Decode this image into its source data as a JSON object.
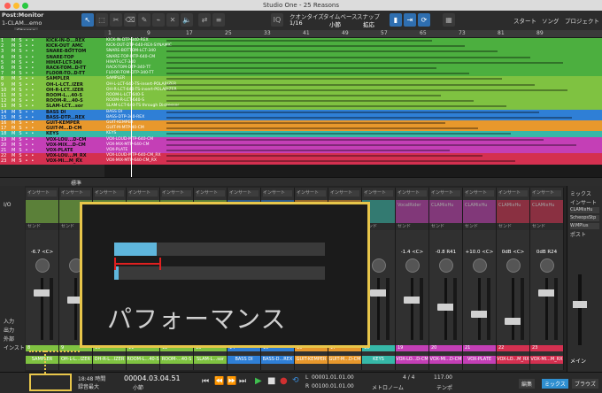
{
  "window": {
    "title": "Studio One - 25 Reasons"
  },
  "song": {
    "line1": "Post:Monitor",
    "line2": "1-CLAM...emo",
    "preset": "Stereo"
  },
  "toolbar": {
    "quantize_label": "クオンタイズ",
    "quantize_value": "1/16",
    "timebase_label": "タイムベース",
    "timebase_value": "小節",
    "snap_label": "スナップ",
    "snap_value": "拡応",
    "start_label": "スタート",
    "song_label": "ソング",
    "project_label": "プロジェクト"
  },
  "ruler": {
    "marks": [
      "1",
      "9",
      "17",
      "25",
      "33",
      "41",
      "49",
      "57",
      "65",
      "73",
      "81",
      "89"
    ]
  },
  "tracks": [
    {
      "num": "1",
      "name": "KICK-IN-D...REX",
      "clip": "KICK-IN-DTP-340-REX",
      "color": "#4caf3f"
    },
    {
      "num": "2",
      "name": "KICK-OUT_AMC",
      "clip": "KICK-OUT-DTP-640-REX-SYNAMIC",
      "color": "#4caf3f"
    },
    {
      "num": "3",
      "name": "SNARE-BOTTOM",
      "clip": "SNARE-BOTTOM-LCT-340",
      "color": "#4caf3f"
    },
    {
      "num": "4",
      "name": "SNARE-TOP",
      "clip": "SNARE-TOP-MTP-640-CM",
      "color": "#4caf3f"
    },
    {
      "num": "5",
      "name": "HIHAT-LCT-340",
      "clip": "HIHAT-LCT-340",
      "color": "#4caf3f"
    },
    {
      "num": "6",
      "name": "RACK-TOM..D-TT",
      "clip": "RACK-TOM-DTP-340-TT",
      "color": "#4caf3f"
    },
    {
      "num": "7",
      "name": "FLOOR-TO..D-TT",
      "clip": "FLOOR-TOM-DTP-340-TT",
      "color": "#4caf3f"
    },
    {
      "num": "8",
      "name": "SAMPLER",
      "clip": "SAMPLER",
      "color": "#7fc241"
    },
    {
      "num": "9",
      "name": "OH-L-LCT..IZER",
      "clip": "OH-L-LCT-640-TS-insert-POLARIZER",
      "color": "#7fc241"
    },
    {
      "num": "10",
      "name": "OH-R-LCT..IZER",
      "clip": "OH-R-LCT-640-TS-insert-POLARIZER",
      "color": "#7fc241"
    },
    {
      "num": "11",
      "name": "ROOM-L...40-S",
      "clip": "ROOM-L-LCT-640-S",
      "color": "#7fc241"
    },
    {
      "num": "12",
      "name": "ROOM-R...40-S",
      "clip": "ROOM-R-LCT-640-S",
      "color": "#7fc241"
    },
    {
      "num": "13",
      "name": "SLAM-LCT...sor",
      "clip": "SLAM-LCT-640-TS through Distressor",
      "color": "#7fc241"
    },
    {
      "num": "14",
      "name": "BASS DI",
      "clip": "BASS DI",
      "color": "#2f7fd6"
    },
    {
      "num": "15",
      "name": "BASS-DTP...REX",
      "clip": "BASS-DTP-340-REX",
      "color": "#2f7fd6"
    },
    {
      "num": "16",
      "name": "GUIT-KEMPER",
      "clip": "GUIT-KEMPER",
      "color": "#e8982c"
    },
    {
      "num": "17",
      "name": "GUIT-M...D-CM",
      "clip": "GUIT-M-MTP-40-CM",
      "color": "#e8982c"
    },
    {
      "num": "18",
      "name": "KEYS",
      "clip": "KEYS",
      "color": "#36b8a8"
    },
    {
      "num": "19",
      "name": "VOX-LOU...D-CM",
      "clip": "VOX-LOUD-MTP-640-CM",
      "color": "#c43fb6"
    },
    {
      "num": "20",
      "name": "VOX-MIX...D-CM",
      "clip": "VOX-MIX-MTP-640-CM",
      "color": "#c43fb6"
    },
    {
      "num": "21",
      "name": "VOX-PLATE",
      "clip": "VOX-PLATE",
      "color": "#c43fb6"
    },
    {
      "num": "22",
      "name": "VOX-LOU...M_RX",
      "clip": "VOX-LOUD-MTP-640-CM_RX",
      "color": "#d43050"
    },
    {
      "num": "23",
      "name": "VOX-MI...M_RX",
      "clip": "VOX-MIX-MTP-640-CM_RX",
      "color": "#d43050"
    }
  ],
  "midbar": {
    "label": "標準"
  },
  "mixer": {
    "left_labels": [
      "I/O",
      "入力",
      "出力",
      "外部",
      "インスト"
    ],
    "insert_label": "インサート",
    "send_label": "センド",
    "strips": [
      {
        "name": "SAMPLER",
        "color": "#7fc241",
        "vol": "-6.7",
        "pan": "<C>",
        "plug": "",
        "num": "8"
      },
      {
        "name": "OH-L-L...IZER",
        "color": "#7fc241",
        "vol": "",
        "pan": "",
        "plug": "",
        "num": "9"
      },
      {
        "name": "OH-R-L...IZER",
        "color": "#7fc241",
        "vol": "",
        "pan": "",
        "plug": "",
        "num": "10"
      },
      {
        "name": "ROOM-L...40-S",
        "color": "#7fc241",
        "vol": "",
        "pan": "",
        "plug": "",
        "num": "11"
      },
      {
        "name": "ROOM-...40-S",
        "color": "#7fc241",
        "vol": "",
        "pan": "",
        "plug": "",
        "num": "12"
      },
      {
        "name": "SLAM-L...sor",
        "color": "#7fc241",
        "vol": "",
        "pan": "",
        "plug": "",
        "num": "13"
      },
      {
        "name": "BASS DI",
        "color": "#2f7fd6",
        "vol": "",
        "pan": "",
        "plug": "",
        "num": "14"
      },
      {
        "name": "BASS-D...REX",
        "color": "#2f7fd6",
        "vol": "",
        "pan": "",
        "plug": "",
        "num": "15"
      },
      {
        "name": "GUIT-KEMPER",
        "color": "#e8982c",
        "vol": "",
        "pan": "",
        "plug": "",
        "num": "16"
      },
      {
        "name": "GUIT-M...D-CM",
        "color": "#e8982c",
        "vol": "",
        "pan": "",
        "plug": "",
        "num": "17"
      },
      {
        "name": "KEYS",
        "color": "#36b8a8",
        "vol": "",
        "pan": "",
        "plug": "",
        "num": "18"
      },
      {
        "name": "VOX-LO...D-CM",
        "color": "#c43fb6",
        "vol": "-1.4",
        "pan": "<C>",
        "plug": "VocalRider",
        "num": "19"
      },
      {
        "name": "VOX-MI...D-CM",
        "color": "#c43fb6",
        "vol": "-0.8",
        "pan": "R41",
        "plug": "CLAMixHu",
        "num": "20"
      },
      {
        "name": "VOX-PLATE",
        "color": "#c43fb6",
        "vol": "+10.0",
        "pan": "<C>",
        "plug": "CLAMixHu",
        "num": "21"
      },
      {
        "name": "VOX-LO...M_RX",
        "color": "#d43050",
        "vol": "0dB",
        "pan": "<C>",
        "plug": "CLAMixHu",
        "num": "22"
      },
      {
        "name": "VOX-MI...M_RX",
        "color": "#d43050",
        "vol": "0dB",
        "pan": "R24",
        "plug": "CLAMixHu",
        "num": "23"
      }
    ],
    "right_panel": {
      "mix_label": "ミックス",
      "insert_label": "インサート",
      "plug1": "CLAMixHu",
      "plug2": "ScheopsStp",
      "plug3": "W.MPlus",
      "post_label": "ポスト",
      "main_label": "メイン"
    }
  },
  "transport": {
    "time": "18:48 時間",
    "record_label": "録音最大",
    "position": "00004.03.04.51",
    "position_unit": "小節",
    "loop_l": "00001.01.01.00",
    "loop_r": "00100.01.01.00",
    "metronome_label": "メトロノーム",
    "timesig": "4 / 4",
    "tempo": "117.00",
    "tempo_label": "テンポ",
    "tabs": [
      "編集",
      "ミックス",
      "ブラウズ"
    ]
  },
  "zoom": {
    "title": "パフォーマンス",
    "bar1_fill": 0.2,
    "bar2_fill": 0.02
  }
}
